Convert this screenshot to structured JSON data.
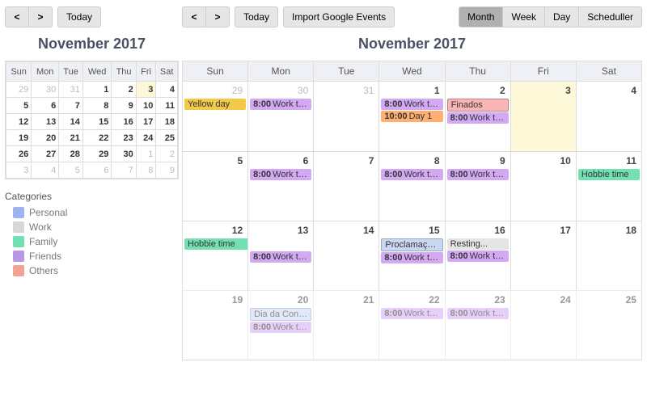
{
  "mini": {
    "toolbar": {
      "prev": "<",
      "next": ">",
      "today": "Today"
    },
    "title": "November 2017",
    "dow": [
      "Sun",
      "Mon",
      "Tue",
      "Wed",
      "Thu",
      "Fri",
      "Sat"
    ],
    "weeks": [
      [
        {
          "n": 29,
          "o": true
        },
        {
          "n": 30,
          "o": true
        },
        {
          "n": 31,
          "o": true
        },
        {
          "n": 1
        },
        {
          "n": 2
        },
        {
          "n": 3,
          "hl": true
        },
        {
          "n": 4
        }
      ],
      [
        {
          "n": 5
        },
        {
          "n": 6
        },
        {
          "n": 7
        },
        {
          "n": 8
        },
        {
          "n": 9
        },
        {
          "n": 10
        },
        {
          "n": 11
        }
      ],
      [
        {
          "n": 12
        },
        {
          "n": 13
        },
        {
          "n": 14
        },
        {
          "n": 15
        },
        {
          "n": 16
        },
        {
          "n": 17
        },
        {
          "n": 18
        }
      ],
      [
        {
          "n": 19
        },
        {
          "n": 20
        },
        {
          "n": 21
        },
        {
          "n": 22
        },
        {
          "n": 23
        },
        {
          "n": 24
        },
        {
          "n": 25
        }
      ],
      [
        {
          "n": 26
        },
        {
          "n": 27
        },
        {
          "n": 28
        },
        {
          "n": 29
        },
        {
          "n": 30
        },
        {
          "n": 1,
          "o": true
        },
        {
          "n": 2,
          "o": true
        }
      ],
      [
        {
          "n": 3,
          "o": true
        },
        {
          "n": 4,
          "o": true
        },
        {
          "n": 5,
          "o": true
        },
        {
          "n": 6,
          "o": true
        },
        {
          "n": 7,
          "o": true
        },
        {
          "n": 8,
          "o": true
        },
        {
          "n": 9,
          "o": true
        }
      ]
    ]
  },
  "categories": {
    "title": "Categories",
    "items": [
      {
        "label": "Personal",
        "color": "#9fb3f2"
      },
      {
        "label": "Work",
        "color": "#d7d7d7"
      },
      {
        "label": "Family",
        "color": "#73e0b3"
      },
      {
        "label": "Friends",
        "color": "#b897e8"
      },
      {
        "label": "Others",
        "color": "#f2a394"
      }
    ]
  },
  "big": {
    "toolbar": {
      "prev": "<",
      "next": ">",
      "today": "Today",
      "import": "Import Google Events"
    },
    "views": {
      "month": "Month",
      "week": "Week",
      "day": "Day",
      "sched": "Scheduller"
    },
    "title": "November 2017",
    "dow": [
      "Sun",
      "Mon",
      "Tue",
      "Wed",
      "Thu",
      "Fri",
      "Sat"
    ],
    "weeks": [
      [
        {
          "n": 29,
          "o": true,
          "ev": [
            {
              "c": "yellow",
              "t": "Yellow day"
            }
          ]
        },
        {
          "n": 30,
          "o": true,
          "ev": [
            {
              "c": "purple",
              "tm": "8:00",
              "t": "Work time"
            }
          ]
        },
        {
          "n": 31,
          "o": true
        },
        {
          "n": 1,
          "ev": [
            {
              "c": "purple",
              "tm": "8:00",
              "t": "Work time"
            },
            {
              "c": "orange",
              "tm": "10:00",
              "t": "Day 1"
            }
          ]
        },
        {
          "n": 2,
          "ev": [
            {
              "c": "pink",
              "t": "Finados"
            },
            {
              "c": "purple",
              "tm": "8:00",
              "t": "Work time"
            }
          ]
        },
        {
          "n": 3,
          "hl": true
        },
        {
          "n": 4
        }
      ],
      [
        {
          "n": 5
        },
        {
          "n": 6,
          "ev": [
            {
              "c": "purple",
              "tm": "8:00",
              "t": "Work time"
            }
          ]
        },
        {
          "n": 7
        },
        {
          "n": 8,
          "ev": [
            {
              "c": "purple",
              "tm": "8:00",
              "t": "Work time"
            }
          ]
        },
        {
          "n": 9,
          "ev": [
            {
              "c": "purple",
              "tm": "8:00",
              "t": "Work time"
            }
          ]
        },
        {
          "n": 10
        },
        {
          "n": 11,
          "ev": [
            {
              "c": "teal",
              "t": "Hobbie time"
            }
          ]
        }
      ],
      [
        {
          "n": 12,
          "span": {
            "c": "teal",
            "t": "Hobbie time"
          }
        },
        {
          "n": 13,
          "ev": [
            {
              "c": "purple",
              "tm": "8:00",
              "t": "Work time"
            }
          ],
          "skipTop": true
        },
        {
          "n": 14
        },
        {
          "n": 15,
          "ev": [
            {
              "c": "lblue",
              "t": "Proclamação da"
            },
            {
              "c": "purple",
              "tm": "8:00",
              "t": "Work time"
            }
          ]
        },
        {
          "n": 16,
          "ev": [
            {
              "c": "gray",
              "t": "Resting..."
            },
            {
              "c": "purple",
              "tm": "8:00",
              "t": "Work time"
            }
          ]
        },
        {
          "n": 17
        },
        {
          "n": 18
        }
      ],
      [
        {
          "n": 19,
          "fade": true
        },
        {
          "n": 20,
          "fade": true,
          "ev": [
            {
              "c": "lblue",
              "t": "Dia da Consciên"
            },
            {
              "c": "purple",
              "tm": "8:00",
              "t": "Work time"
            }
          ]
        },
        {
          "n": 21,
          "fade": true
        },
        {
          "n": 22,
          "fade": true,
          "ev": [
            {
              "c": "purple",
              "tm": "8:00",
              "t": "Work time"
            }
          ]
        },
        {
          "n": 23,
          "fade": true,
          "ev": [
            {
              "c": "purple",
              "tm": "8:00",
              "t": "Work time"
            }
          ]
        },
        {
          "n": 24,
          "fade": true
        },
        {
          "n": 25,
          "fade": true
        }
      ]
    ]
  }
}
